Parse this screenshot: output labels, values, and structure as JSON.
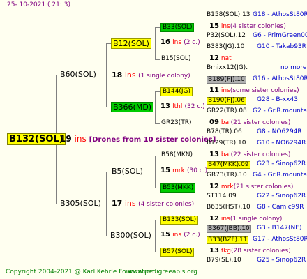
{
  "header": {
    "timestamp": "25- 10-2021 ( 21:  3)"
  },
  "root": {
    "name": "B132(SOL)",
    "count": "19",
    "unit": "ins",
    "note": "[Drones from 10 sister colonies]"
  },
  "gen2": [
    {
      "name": "B60(SOL)"
    },
    {
      "name": "B305(SOL)"
    }
  ],
  "gen3": [
    {
      "name": "B12(SOL)"
    },
    {
      "name": "B366(MD)"
    },
    {
      "name": "B5(SOL)"
    },
    {
      "name": "B300(SOL)"
    }
  ],
  "gen3info": [
    {
      "count": "18",
      "unit": "ins",
      "note": "(1 single colony)"
    },
    {
      "count": "17",
      "unit": "ins",
      "note": "(4 sister colonies)"
    }
  ],
  "gen4": [
    {
      "name": "B33(SOL)"
    },
    {
      "name": "B15(SOL)"
    },
    {
      "name": "B144(JG)"
    },
    {
      "name": "GR23(TR)"
    },
    {
      "name": "B58(MKN)"
    },
    {
      "name": "B53(MKK)"
    },
    {
      "name": "B133(SOL)"
    },
    {
      "name": "B57(SOL)"
    }
  ],
  "gen4info": [
    {
      "count": "16",
      "unit": "ins",
      "note": "(2 c.)"
    },
    {
      "count": "13",
      "unit": "lthl",
      "note": "(32 c.)"
    },
    {
      "count": "15",
      "unit": "mrk",
      "note": "(30 c.)"
    },
    {
      "count": "15",
      "unit": "ins",
      "note": "(2 c.)"
    }
  ],
  "gen5": [
    {
      "kind": "queen",
      "name": "B158(SOL).13",
      "code": "G18 - AthosSt80R",
      "hl": ""
    },
    {
      "kind": "count",
      "count": "15",
      "unit": "ins",
      "note": "(4 sister colonies)"
    },
    {
      "kind": "queen",
      "name": "P32(SOL).12",
      "code": "G6 - PrimGreen00",
      "hl": ""
    },
    {
      "kind": "queen",
      "name": "B383(JG).10",
      "code": "G10 - Takab93R",
      "hl": ""
    },
    {
      "kind": "count",
      "count": "12",
      "unit": "nat",
      "note": ""
    },
    {
      "kind": "queen",
      "name": "Bmixx12(JG).",
      "code": "no more",
      "hl": ""
    },
    {
      "kind": "queen",
      "name": "B189(PJ).10",
      "code": "G16 - AthosSt80R",
      "hl": "gray"
    },
    {
      "kind": "count",
      "count": "11",
      "unit": "ins",
      "note": "(some sister colonies)"
    },
    {
      "kind": "queen",
      "name": "B190(PJ).06",
      "code": "G28 - B-xx43",
      "hl": "yellow"
    },
    {
      "kind": "queen",
      "name": "GR22(TR).08",
      "code": "G2 - Gr.R.mounta",
      "hl": ""
    },
    {
      "kind": "count",
      "count": "09",
      "unit": "bal",
      "note": "(21 sister colonies)"
    },
    {
      "kind": "queen",
      "name": "B78(TR).06",
      "code": "G8 - NO6294R",
      "hl": ""
    },
    {
      "kind": "queen",
      "name": "B129(TR).10",
      "code": "G10 - NO6294R",
      "hl": ""
    },
    {
      "kind": "count",
      "count": "13",
      "unit": "bal",
      "note": "(22 sister colonies)"
    },
    {
      "kind": "queen",
      "name": "B47(MKK).09",
      "code": "G23 - Sinop62R",
      "hl": "yellow"
    },
    {
      "kind": "queen",
      "name": "GR73(TR).10",
      "code": "G4 - Gr.R.mounta",
      "hl": ""
    },
    {
      "kind": "count",
      "count": "12",
      "unit": "mrk",
      "note": "(21 sister colonies)"
    },
    {
      "kind": "queen",
      "name": "ST114.09",
      "code": "G22 - Sinop62R",
      "hl": ""
    },
    {
      "kind": "queen",
      "name": "B635(HST).10",
      "code": "G8 - Camic99R",
      "hl": ""
    },
    {
      "kind": "count",
      "count": "12",
      "unit": "ins",
      "note": "(1 single colony)"
    },
    {
      "kind": "queen",
      "name": "B367(JBB).10",
      "code": "G3 - B147(NE)",
      "hl": "gray"
    },
    {
      "kind": "queen",
      "name": "B33(BZF).11",
      "code": "G17 - AthosSt80R",
      "hl": "yellow"
    },
    {
      "kind": "count",
      "count": "13",
      "unit": "fkg",
      "note": "(28 sister colonies)"
    },
    {
      "kind": "queen",
      "name": "B79(SL).10",
      "code": "G25 - Sinop62R",
      "hl": ""
    }
  ],
  "footer": {
    "copyright": "Copyright 2004-2021 @ Karl Kehrle Foundation",
    "site": "www.pedigreeapis.org"
  }
}
